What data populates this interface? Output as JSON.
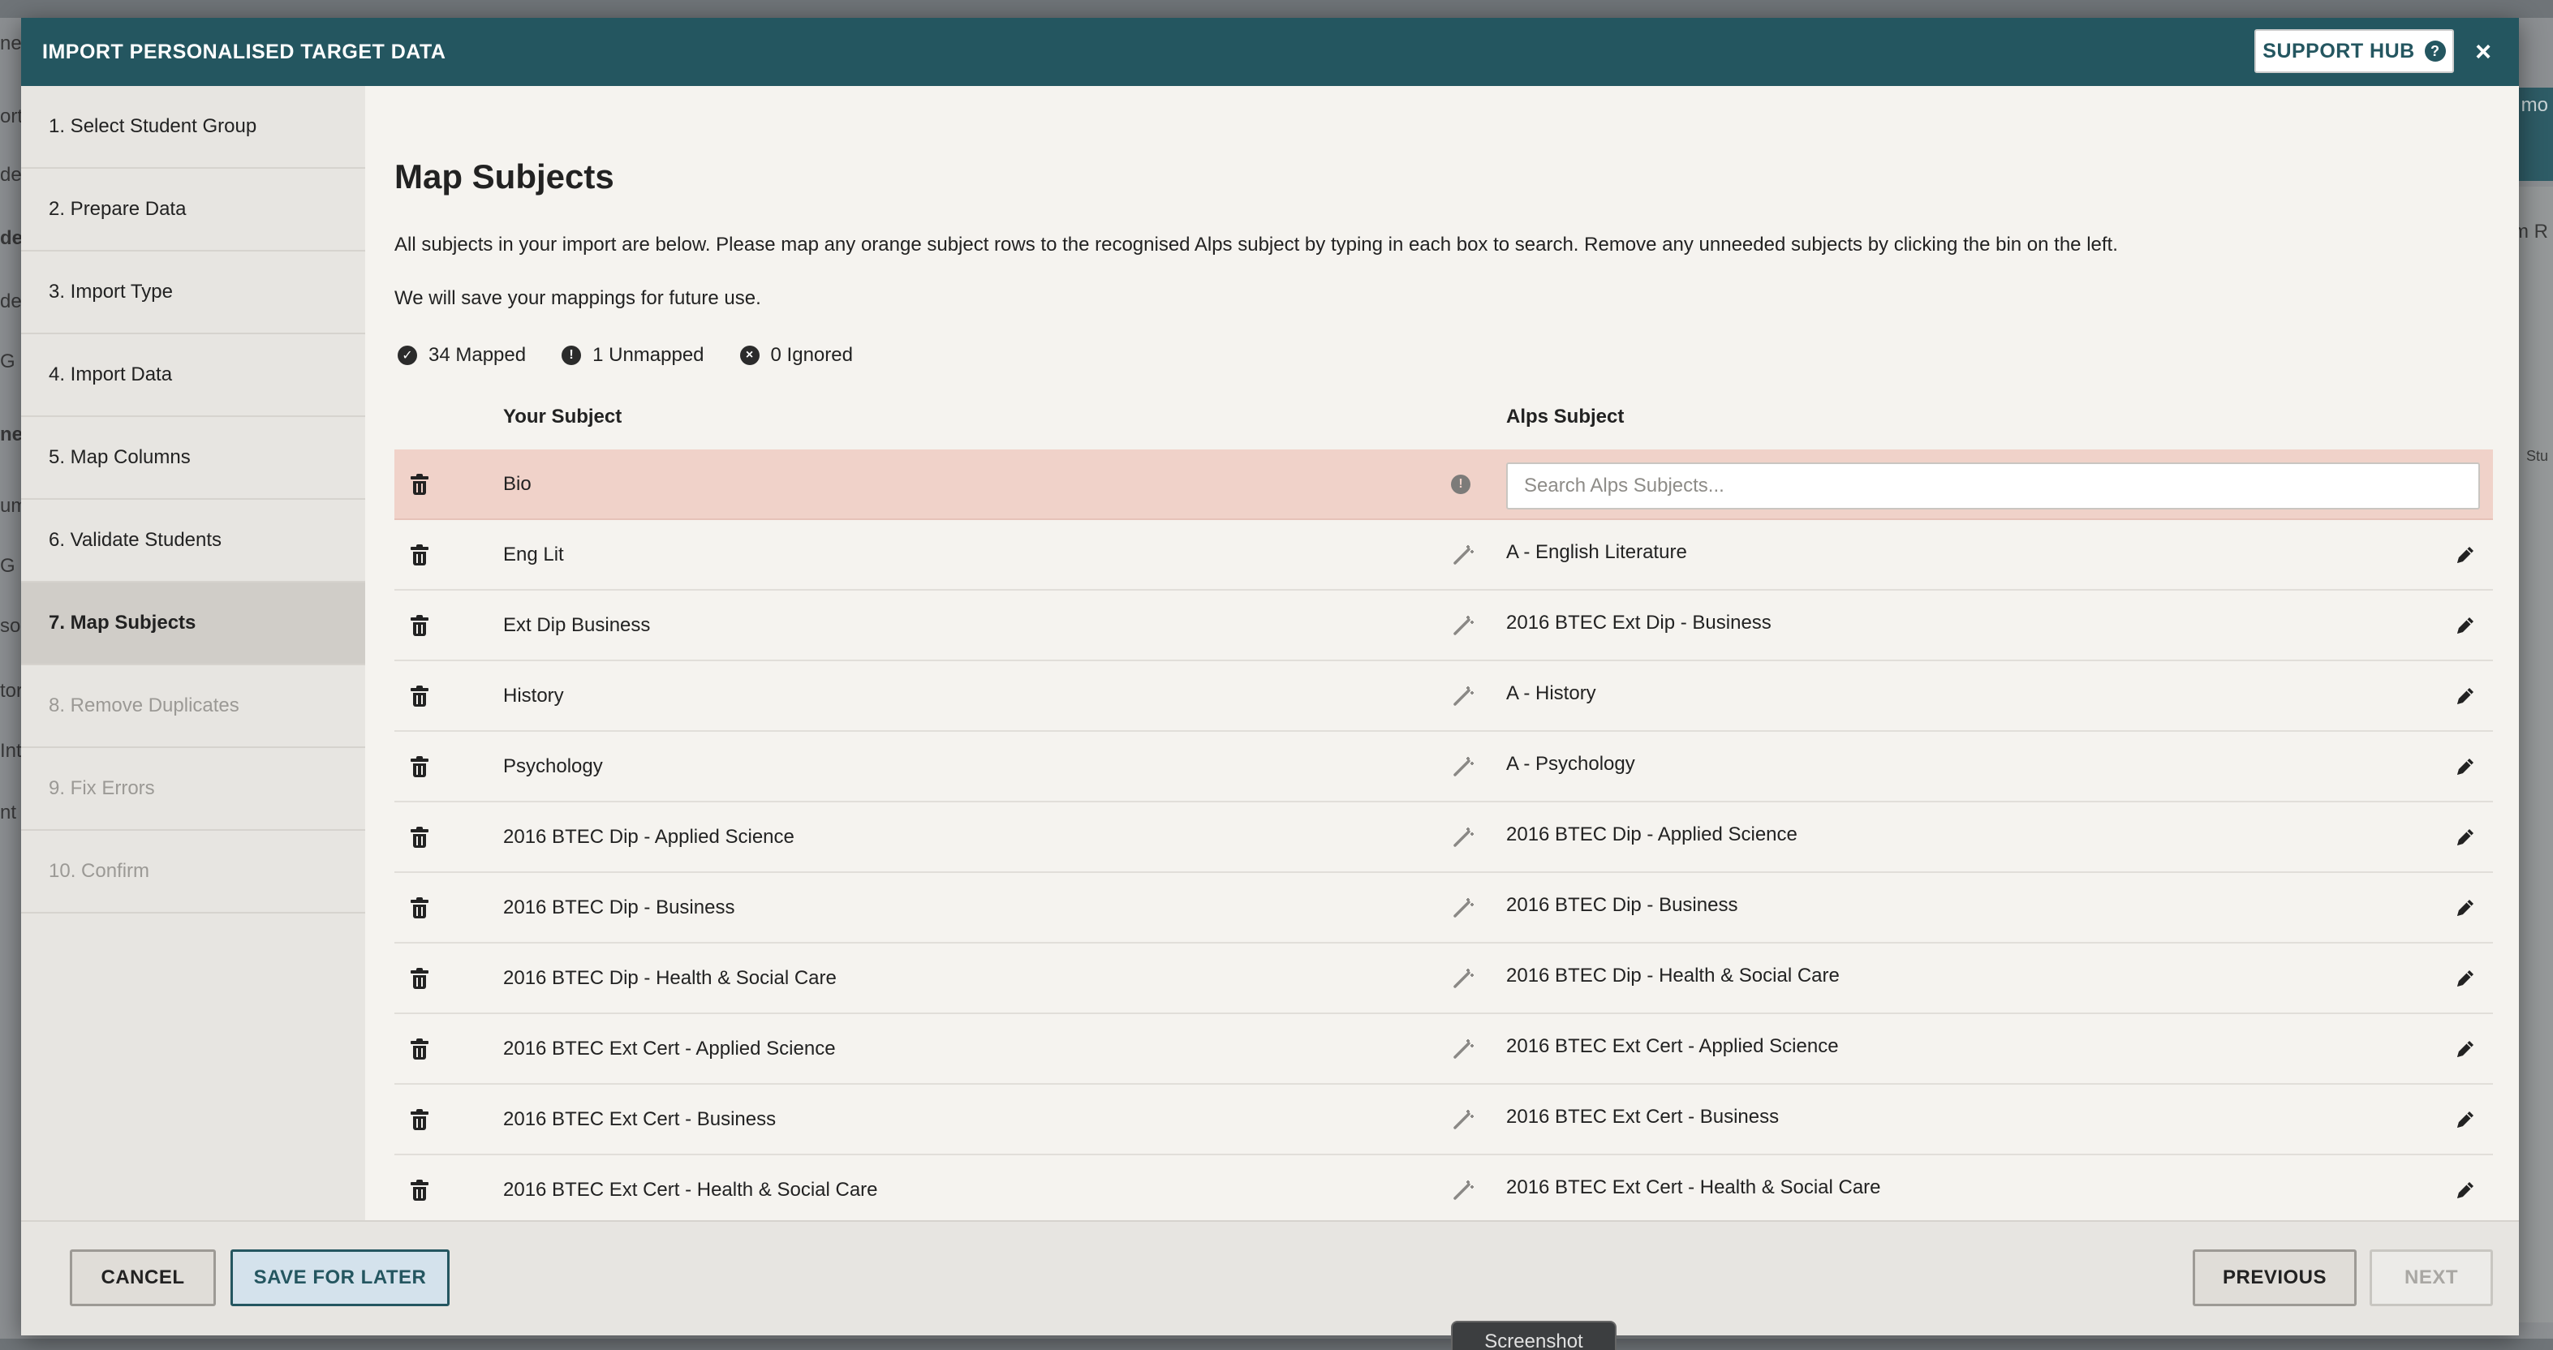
{
  "modal": {
    "title": "IMPORT PERSONALISED TARGET DATA",
    "support_hub_label": "SUPPORT HUB",
    "help_glyph": "?",
    "close_glyph": "×"
  },
  "steps": [
    {
      "label": "1. Select Student Group",
      "state": "done"
    },
    {
      "label": "2. Prepare Data",
      "state": "done"
    },
    {
      "label": "3. Import Type",
      "state": "done"
    },
    {
      "label": "4. Import Data",
      "state": "done"
    },
    {
      "label": "5. Map Columns",
      "state": "done"
    },
    {
      "label": "6. Validate Students",
      "state": "done"
    },
    {
      "label": "7. Map Subjects",
      "state": "active"
    },
    {
      "label": "8. Remove Duplicates",
      "state": "disabled"
    },
    {
      "label": "9. Fix Errors",
      "state": "disabled"
    },
    {
      "label": "10. Confirm",
      "state": "disabled"
    }
  ],
  "main": {
    "title": "Map Subjects",
    "intro_line1": "All subjects in your import are below. Please map any orange subject rows to the recognised Alps subject by typing in each box to search. Remove any unneeded subjects by clicking the bin on the left.",
    "intro_line2": "We will save your mappings for future use.",
    "stats": {
      "mapped": "34 Mapped",
      "unmapped": "1 Unmapped",
      "ignored": "0 Ignored"
    },
    "columns": {
      "your_subject": "Your Subject",
      "alps_subject": "Alps Subject"
    },
    "search_placeholder": "Search Alps Subjects...",
    "rows": [
      {
        "your": "Bio",
        "alps": "",
        "status": "unmapped"
      },
      {
        "your": "Eng Lit",
        "alps": "A - English Literature",
        "status": "mapped"
      },
      {
        "your": "Ext Dip Business",
        "alps": "2016 BTEC Ext Dip - Business",
        "status": "mapped"
      },
      {
        "your": "History",
        "alps": "A - History",
        "status": "mapped"
      },
      {
        "your": "Psychology",
        "alps": "A - Psychology",
        "status": "mapped"
      },
      {
        "your": "2016 BTEC Dip - Applied Science",
        "alps": "2016 BTEC Dip - Applied Science",
        "status": "mapped"
      },
      {
        "your": "2016 BTEC Dip - Business",
        "alps": "2016 BTEC Dip - Business",
        "status": "mapped"
      },
      {
        "your": "2016 BTEC Dip - Health & Social Care",
        "alps": "2016 BTEC Dip - Health & Social Care",
        "status": "mapped"
      },
      {
        "your": "2016 BTEC Ext Cert - Applied Science",
        "alps": "2016 BTEC Ext Cert - Applied Science",
        "status": "mapped"
      },
      {
        "your": "2016 BTEC Ext Cert - Business",
        "alps": "2016 BTEC Ext Cert - Business",
        "status": "mapped"
      },
      {
        "your": "2016 BTEC Ext Cert - Health & Social Care",
        "alps": "2016 BTEC Ext Cert - Health & Social Care",
        "status": "mapped"
      }
    ]
  },
  "footer": {
    "cancel": "CANCEL",
    "save_for_later": "SAVE FOR LATER",
    "previous": "PREVIOUS",
    "next": "NEXT"
  },
  "overlay": {
    "screenshot_label": "Screenshot"
  },
  "background": {
    "left_fragments": [
      "ne",
      "ort",
      "dep",
      "der",
      "de",
      "G R",
      "ne",
      "um",
      "G",
      "so",
      "tor",
      "Int",
      "nt V"
    ],
    "right_fragments": [
      "t mo",
      "m R",
      "Stu"
    ]
  },
  "colors": {
    "header": "#245660",
    "unmapped_row": "#f0d2c9",
    "sidebar": "#e7e5e1",
    "active_step": "#d0cdc8"
  }
}
